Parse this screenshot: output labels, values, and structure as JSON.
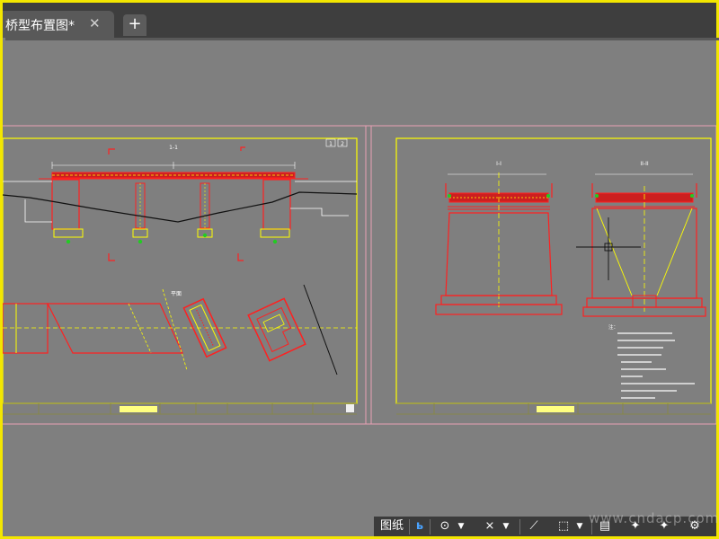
{
  "tab": {
    "title": "桥型布置图*",
    "close_glyph": "✕",
    "new_glyph": "+"
  },
  "sheet1": {
    "section_mark": "1-1",
    "plan_mark": "平面",
    "page_labels": [
      "1",
      "2"
    ]
  },
  "sheet2": {
    "section_a": "I-I",
    "section_b": "II-II",
    "notes_header": "注："
  },
  "statusbar": {
    "layout_label": "图纸"
  },
  "watermark": "www.cndacp.com",
  "colors": {
    "drawing_red": "#ff2020",
    "drawing_yellow": "#ffff00",
    "background": "#7f7f7f",
    "frame": "#f3e600"
  }
}
